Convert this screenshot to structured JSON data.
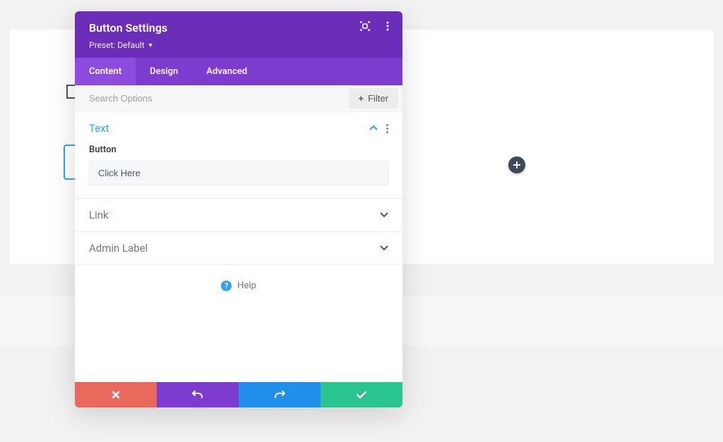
{
  "canvas": {
    "plus_button_aria": "Add Module"
  },
  "modal": {
    "title": "Button Settings",
    "preset_label": "Preset: Default",
    "header_actions": {
      "expand_aria": "Expand",
      "menu_aria": "More Options"
    },
    "tabs": {
      "content": "Content",
      "design": "Design",
      "advanced": "Advanced"
    },
    "search": {
      "placeholder": "Search Options",
      "filter_label": "Filter"
    },
    "sections": {
      "text": {
        "title": "Text",
        "field_label": "Button",
        "field_value": "Click Here"
      },
      "link": {
        "title": "Link"
      },
      "admin_label": {
        "title": "Admin Label"
      }
    },
    "help_label": "Help",
    "footer": {
      "close_aria": "Discard",
      "undo_aria": "Undo",
      "redo_aria": "Redo",
      "confirm_aria": "Save"
    }
  }
}
